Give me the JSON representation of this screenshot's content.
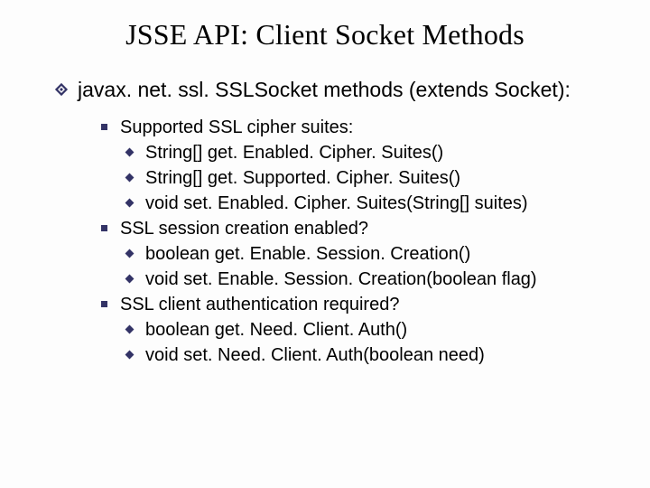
{
  "title": "JSSE API: Client Socket Methods",
  "l1_text": "javax. net. ssl. SSLSocket methods (extends Socket):",
  "groups": [
    {
      "heading": "Supported SSL cipher suites:",
      "items": [
        "String[] get. Enabled. Cipher. Suites()",
        "String[] get. Supported. Cipher. Suites()",
        "void set. Enabled. Cipher. Suites(String[] suites)"
      ]
    },
    {
      "heading": "SSL session creation enabled?",
      "items": [
        "boolean get. Enable. Session. Creation()",
        "void set. Enable. Session. Creation(boolean flag)"
      ]
    },
    {
      "heading": "SSL client authentication required?",
      "items": [
        "boolean get. Need. Client. Auth()",
        "void set. Need. Client. Auth(boolean need)"
      ]
    }
  ]
}
